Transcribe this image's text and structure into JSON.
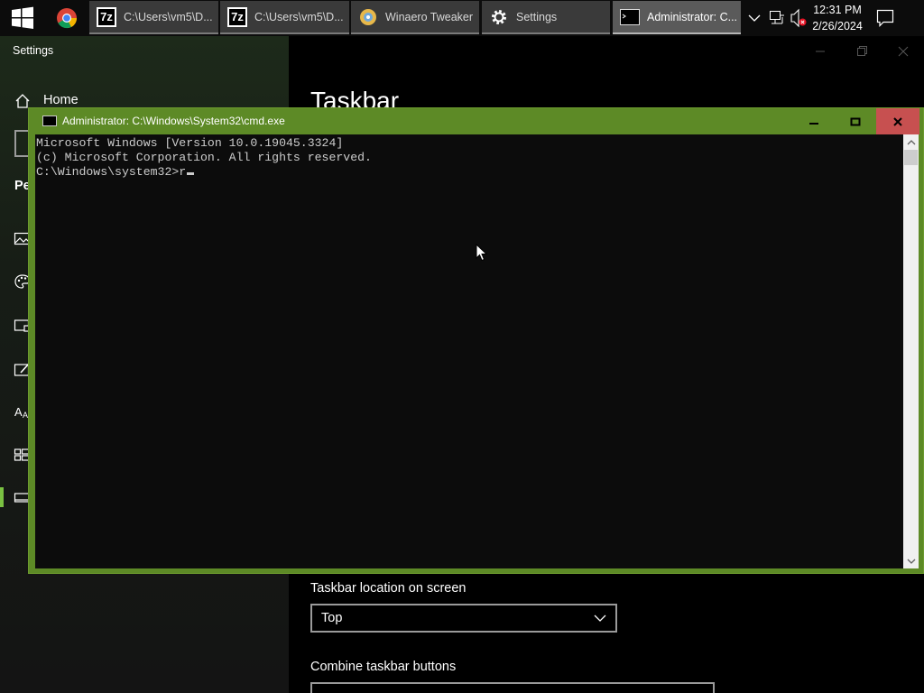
{
  "taskbar": {
    "buttons": [
      {
        "label": "C:\\Users\\vm5\\D...",
        "icon": "7zip-icon"
      },
      {
        "label": "C:\\Users\\vm5\\D...",
        "icon": "7zip-icon"
      },
      {
        "label": "Winaero Tweaker",
        "icon": "winaero-tweaker-icon"
      },
      {
        "label": "Settings",
        "icon": "gear-icon"
      },
      {
        "label": "Administrator: C...",
        "icon": "cmd-icon"
      }
    ],
    "icon_7z_text": "7z",
    "clock": {
      "time": "12:31 PM",
      "date": "2/26/2024"
    }
  },
  "settings": {
    "window_title": "Settings",
    "home_label": "Home",
    "section_fragment": "Pe",
    "page_title": "Taskbar",
    "location_label": "Taskbar location on screen",
    "location_value": "Top",
    "combine_label": "Combine taskbar buttons",
    "accent": "#7ac142"
  },
  "cmd": {
    "title": "Administrator: C:\\Windows\\System32\\cmd.exe",
    "lines": [
      "Microsoft Windows [Version 10.0.19045.3324]",
      "(c) Microsoft Corporation. All rights reserved.",
      "",
      "C:\\Windows\\system32>r"
    ],
    "frame_color": "#5d8a26",
    "close_color": "#c75050"
  }
}
